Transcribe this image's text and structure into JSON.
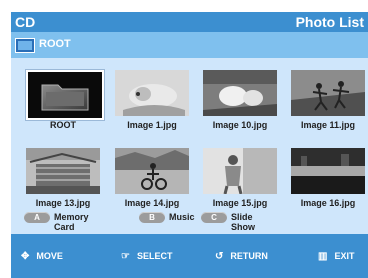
{
  "header": {
    "title_left": "CD",
    "title_right": "Photo List"
  },
  "path": {
    "label": "ROOT"
  },
  "thumbnails": [
    {
      "label": "ROOT",
      "icon": "folder-icon"
    },
    {
      "label": "Image 1.jpg"
    },
    {
      "label": "Image 10.jpg"
    },
    {
      "label": "Image 11.jpg"
    },
    {
      "label": "Image 13.jpg"
    },
    {
      "label": "Image 14.jpg"
    },
    {
      "label": "Image 15.jpg"
    },
    {
      "label": "Image 16.jpg"
    }
  ],
  "color_buttons": [
    {
      "key": "A",
      "label": "Memory Card"
    },
    {
      "key": "B",
      "label": "Music"
    },
    {
      "key": "C",
      "label": "Slide Show"
    }
  ],
  "bottom_nav": [
    {
      "icon": "move-icon",
      "label": "MOVE"
    },
    {
      "icon": "select-icon",
      "label": "SELECT"
    },
    {
      "icon": "return-icon",
      "label": "RETURN"
    },
    {
      "icon": "exit-icon",
      "label": "EXIT"
    }
  ],
  "colors": {
    "accent": "#3c8fd0",
    "path_bar": "#7fc0ee",
    "content_bg": "#cfe6fb"
  }
}
